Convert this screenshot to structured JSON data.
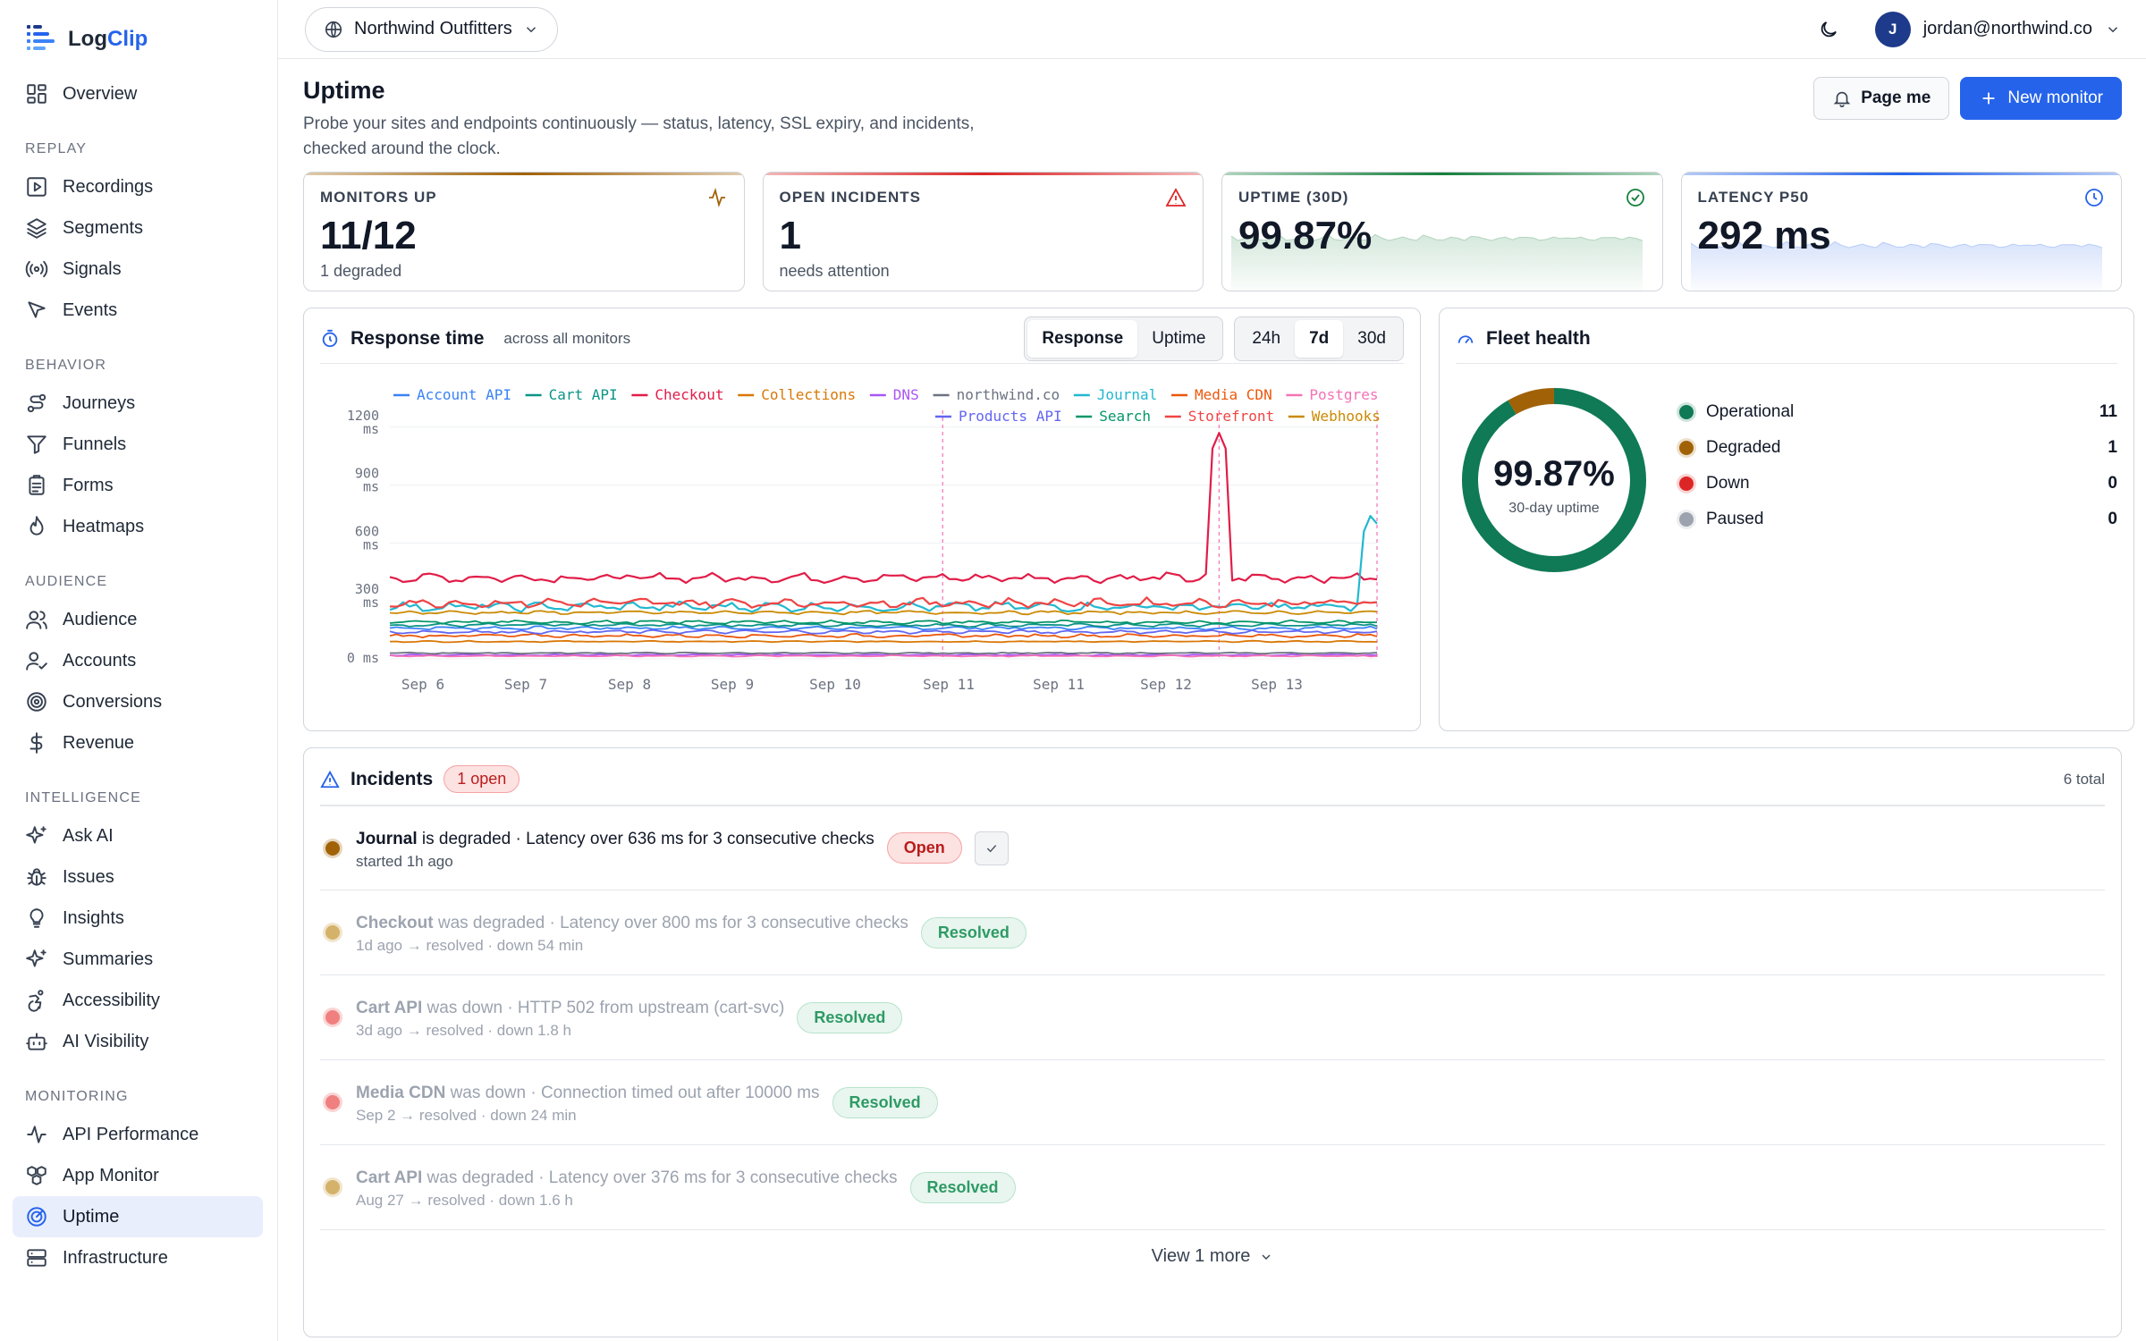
{
  "brand": {
    "name_a": "Log",
    "name_b": "Clip"
  },
  "sidebar": {
    "top": [
      {
        "label": "Overview",
        "icon": "grid-icon"
      }
    ],
    "sections": [
      {
        "title": "REPLAY",
        "items": [
          {
            "label": "Recordings",
            "icon": "play-square-icon"
          },
          {
            "label": "Segments",
            "icon": "layers-icon"
          },
          {
            "label": "Signals",
            "icon": "radio-icon"
          },
          {
            "label": "Events",
            "icon": "cursor-icon"
          }
        ]
      },
      {
        "title": "BEHAVIOR",
        "items": [
          {
            "label": "Journeys",
            "icon": "route-icon"
          },
          {
            "label": "Funnels",
            "icon": "funnel-icon"
          },
          {
            "label": "Forms",
            "icon": "clipboard-icon"
          },
          {
            "label": "Heatmaps",
            "icon": "flame-icon"
          }
        ]
      },
      {
        "title": "AUDIENCE",
        "items": [
          {
            "label": "Audience",
            "icon": "users-icon"
          },
          {
            "label": "Accounts",
            "icon": "user-check-icon"
          },
          {
            "label": "Conversions",
            "icon": "target-icon"
          },
          {
            "label": "Revenue",
            "icon": "dollar-icon"
          }
        ]
      },
      {
        "title": "INTELLIGENCE",
        "items": [
          {
            "label": "Ask AI",
            "icon": "sparkles-icon"
          },
          {
            "label": "Issues",
            "icon": "bug-icon"
          },
          {
            "label": "Insights",
            "icon": "lightbulb-icon"
          },
          {
            "label": "Summaries",
            "icon": "sparkles-icon"
          },
          {
            "label": "Accessibility",
            "icon": "accessibility-icon"
          },
          {
            "label": "AI Visibility",
            "icon": "bot-icon"
          }
        ]
      },
      {
        "title": "MONITORING",
        "items": [
          {
            "label": "API Performance",
            "icon": "activity-icon"
          },
          {
            "label": "App Monitor",
            "icon": "boxes-icon"
          },
          {
            "label": "Uptime",
            "icon": "radar-icon",
            "active": true
          },
          {
            "label": "Infrastructure",
            "icon": "server-icon"
          }
        ]
      }
    ]
  },
  "topbar": {
    "org": "Northwind Outfitters",
    "user_initial": "J",
    "user_email": "jordan@northwind.co"
  },
  "page": {
    "title": "Uptime",
    "description": "Probe your sites and endpoints continuously — status, latency, SSL expiry, and incidents, checked around the clock.",
    "page_me": "Page me",
    "new_monitor": "New monitor"
  },
  "kpis": [
    {
      "label": "MONITORS UP",
      "value": "11/12",
      "sub": "1 degraded",
      "color": "#a16207",
      "icon": "activity-icon"
    },
    {
      "label": "OPEN INCIDENTS",
      "value": "1",
      "sub": "needs attention",
      "color": "#dc2626",
      "icon": "alert-triangle-icon"
    },
    {
      "label": "UPTIME (30D)",
      "value": "99.87%",
      "sub": "",
      "color": "#15803d",
      "icon": "check-circle-icon"
    },
    {
      "label": "LATENCY P50",
      "value": "292 ms",
      "sub": "",
      "color": "#2563eb",
      "icon": "clock-icon"
    }
  ],
  "response": {
    "title": "Response time",
    "subtitle": "across all monitors",
    "modes": [
      "Response",
      "Uptime"
    ],
    "ranges": [
      "24h",
      "7d",
      "30d"
    ]
  },
  "chart_data": {
    "type": "line",
    "title": "",
    "xlabel": "",
    "ylabel": "",
    "y_ticks": [
      "0 ms",
      "300 ms",
      "600 ms",
      "900 ms",
      "1200 ms"
    ],
    "ylim": [
      0,
      1250
    ],
    "x_ticks": [
      "Sep 6",
      "Sep 7",
      "Sep 8",
      "Sep 9",
      "Sep 10",
      "Sep 11",
      "Sep 11",
      "Sep 12",
      "Sep 13"
    ],
    "grid": true,
    "legend_position": "top",
    "series": [
      {
        "name": "Account API",
        "color": "#3b82f6",
        "base": 160
      },
      {
        "name": "Cart API",
        "color": "#0d9488",
        "base": 175
      },
      {
        "name": "Checkout",
        "color": "#e11d48",
        "base": 420,
        "spike": {
          "at": 0.84,
          "value": 1170
        }
      },
      {
        "name": "Collections",
        "color": "#d97706",
        "base": 90
      },
      {
        "name": "DNS",
        "color": "#a855f7",
        "base": 20
      },
      {
        "name": "northwind.co",
        "color": "#6b7280",
        "base": 30
      },
      {
        "name": "Journal",
        "color": "#22b8cf",
        "base": 270,
        "spike": {
          "at": 0.995,
          "value": 760
        }
      },
      {
        "name": "Media CDN",
        "color": "#ea580c",
        "base": 120
      },
      {
        "name": "Postgres",
        "color": "#f472b6",
        "base": 15
      },
      {
        "name": "Products API",
        "color": "#6366f1",
        "base": 140
      },
      {
        "name": "Search",
        "color": "#059669",
        "base": 190
      },
      {
        "name": "Storefront",
        "color": "#ef4444",
        "base": 290
      },
      {
        "name": "Webhooks",
        "color": "#ca8a04",
        "base": 240
      }
    ],
    "markers": [
      0.56,
      0.84,
      1.0
    ]
  },
  "fleet": {
    "title": "Fleet health",
    "uptime": "99.87%",
    "uptime_label": "30-day uptime",
    "segments": [
      {
        "label": "Operational",
        "count": "11",
        "color": "#0f7a55",
        "fraction": 0.9167
      },
      {
        "label": "Degraded",
        "count": "1",
        "color": "#a16207",
        "fraction": 0.0833
      },
      {
        "label": "Down",
        "count": "0",
        "color": "#dc2626",
        "fraction": 0
      },
      {
        "label": "Paused",
        "count": "0",
        "color": "#9ca3af",
        "fraction": 0
      }
    ]
  },
  "incidents": {
    "title": "Incidents",
    "open_badge": "1 open",
    "total": "6 total",
    "items": [
      {
        "name": "Journal",
        "verb": " is degraded",
        "detail": " · Latency over 636 ms for 3 consecutive checks",
        "meta": "started 1h ago",
        "status": "Open",
        "dot": "#a16207",
        "resolved": false
      },
      {
        "name": "Checkout",
        "verb": " was degraded",
        "detail": " · Latency over 800 ms for 3 consecutive checks",
        "meta": "1d ago → resolved · down 54 min",
        "status": "Resolved",
        "dot": "#d4b26a",
        "resolved": true
      },
      {
        "name": "Cart API",
        "verb": " was down",
        "detail": " · HTTP 502 from upstream (cart-svc)",
        "meta": "3d ago → resolved · down 1.8 h",
        "status": "Resolved",
        "dot": "#f08080",
        "resolved": true
      },
      {
        "name": "Media CDN",
        "verb": " was down",
        "detail": " · Connection timed out after 10000 ms",
        "meta": "Sep 2 → resolved · down 24 min",
        "status": "Resolved",
        "dot": "#f08080",
        "resolved": true
      },
      {
        "name": "Cart API",
        "verb": " was degraded",
        "detail": " · Latency over 376 ms for 3 consecutive checks",
        "meta": "Aug 27 → resolved · down 1.6 h",
        "status": "Resolved",
        "dot": "#d4b26a",
        "resolved": true
      }
    ],
    "view_more": "View 1 more"
  }
}
